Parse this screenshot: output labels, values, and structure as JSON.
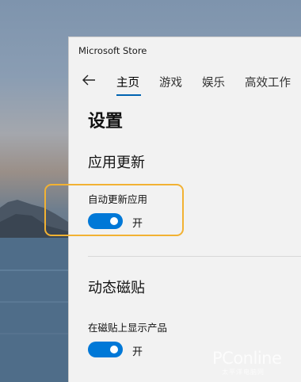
{
  "window": {
    "title": "Microsoft Store"
  },
  "nav": {
    "back_icon": "back-arrow-icon",
    "tabs": [
      {
        "label": "主页",
        "active": true
      },
      {
        "label": "游戏",
        "active": false
      },
      {
        "label": "娱乐",
        "active": false
      },
      {
        "label": "高效工作",
        "active": false
      }
    ]
  },
  "page": {
    "title": "设置",
    "sections": [
      {
        "title": "应用更新",
        "setting": {
          "label": "自动更新应用",
          "state_text": "开",
          "on": true
        }
      },
      {
        "title": "动态磁贴",
        "setting": {
          "label": "在磁贴上显示产品",
          "state_text": "开",
          "on": true
        }
      }
    ]
  },
  "colors": {
    "accent": "#0078d7",
    "tab_underline": "#0063b1",
    "highlight": "#f2b233",
    "window_bg": "#f2f2f2"
  },
  "watermark": {
    "main": "PConline",
    "sub": "太平洋电脑网"
  }
}
